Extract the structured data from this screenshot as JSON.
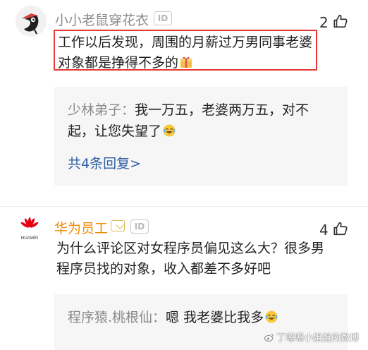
{
  "comments": [
    {
      "username": "小小老鼠穿花衣",
      "id_badge": "ID",
      "like_count": "2",
      "body": "工作以后发现，周围的月薪过万男同事老婆对象都是挣得不多的",
      "reply": {
        "author": "少林弟子：",
        "text": "我一万五，老婆两万五，对不起，让您失望了"
      },
      "reply_link": "共4条回复>"
    },
    {
      "username": "华为员工",
      "id_badge": "ID",
      "like_count": "4",
      "body": "为什么评论区对女程序员偏见这么大？很多男程序员找的对象，收入都差不多好吧",
      "reply": {
        "author": "程序猿.桃根仙：",
        "text": "嗯 我老婆比我多"
      }
    }
  ],
  "brand": {
    "huawei_label": "HUAWEI"
  },
  "watermark": "丁嗯嗯小姐姐的微博",
  "colors": {
    "highlight": "#e53935",
    "link": "#2f5fa5",
    "vip_username": "#f08a00",
    "huawei_red": "#e60012"
  },
  "icons": {
    "like": "thumbs-up-icon",
    "reply_emoji": "tears-of-joy-emoji",
    "gift_emoji": "gift-emoji"
  }
}
